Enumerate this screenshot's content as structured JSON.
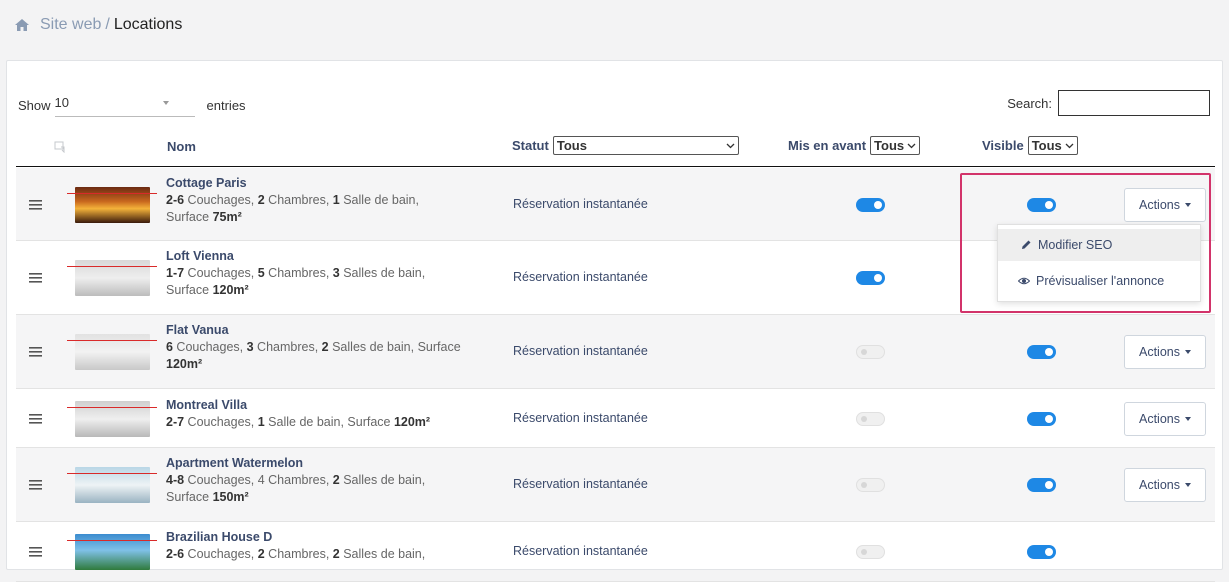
{
  "breadcrumb": {
    "link": "Site web",
    "separator": "/",
    "current": "Locations"
  },
  "table_controls": {
    "show_label": "Show",
    "length_value": "10",
    "entries_label": "entries",
    "search_label": "Search:",
    "search_value": ""
  },
  "columns": {
    "name": "Nom",
    "status": "Statut",
    "status_filter": "Tous",
    "featured": "Mis en avant",
    "featured_filter": "Tous",
    "visible": "Visible",
    "visible_filter": "Tous"
  },
  "actions_label": "Actions",
  "dropdown_menu": [
    {
      "label": "Modifier SEO",
      "icon": "pencil-icon"
    },
    {
      "label": "Prévisualiser l'annonce",
      "icon": "eye-icon"
    }
  ],
  "rows": [
    {
      "title": "Cottage Paris",
      "seg1": "2-6",
      "t1": " Couchages, ",
      "seg2": "2",
      "t2": " Chambres, ",
      "seg3": "1",
      "t3": " Salle de bain,",
      "t4": "Surface ",
      "seg4": "75m²",
      "status": "Réservation instantanée",
      "featured": true,
      "visible": true
    },
    {
      "title": "Loft Vienna",
      "seg1": "1-7",
      "t1": " Couchages, ",
      "seg2": "5",
      "t2": " Chambres, ",
      "seg3": "3",
      "t3": " Salles de bain,",
      "t4": "Surface ",
      "seg4": "120m²",
      "status": "Réservation instantanée",
      "featured": true,
      "visible": true
    },
    {
      "title": "Flat Vanua",
      "seg1": "6",
      "t1": " Couchages, ",
      "seg2": "3",
      "t2": " Chambres, ",
      "seg3": "2",
      "t3": " Salles de bain, Surface",
      "t4": "",
      "seg4": "120m²",
      "status": "Réservation instantanée",
      "featured": false,
      "visible": true
    },
    {
      "title": "Montreal Villa",
      "seg1": "2-7",
      "t1": " Couchages, ",
      "seg2": "1",
      "t2": " Salle de bain, Surface ",
      "seg3": "120m²",
      "t3": "",
      "t4": "",
      "seg4": "",
      "status": "Réservation instantanée",
      "featured": false,
      "visible": true
    },
    {
      "title": "Apartment Watermelon",
      "seg1": "4-8",
      "t1": " Couchages, 4 Chambres, ",
      "seg2": "2",
      "t2": " Salles de bain,",
      "seg3": "",
      "t3": "",
      "t4": "Surface ",
      "seg4": "150m²",
      "status": "Réservation instantanée",
      "featured": false,
      "visible": true
    },
    {
      "title": "Brazilian House D",
      "seg1": "2-6",
      "t1": " Couchages, ",
      "seg2": "2",
      "t2": " Chambres, ",
      "seg3": "2",
      "t3": " Salles de bain,",
      "t4": "",
      "seg4": "",
      "status": "Réservation instantanée",
      "featured": false,
      "visible": true
    }
  ],
  "colors": {
    "toggle_on": "#1e88e5",
    "highlight": "#d2336a",
    "link": "#3b4a6b"
  }
}
